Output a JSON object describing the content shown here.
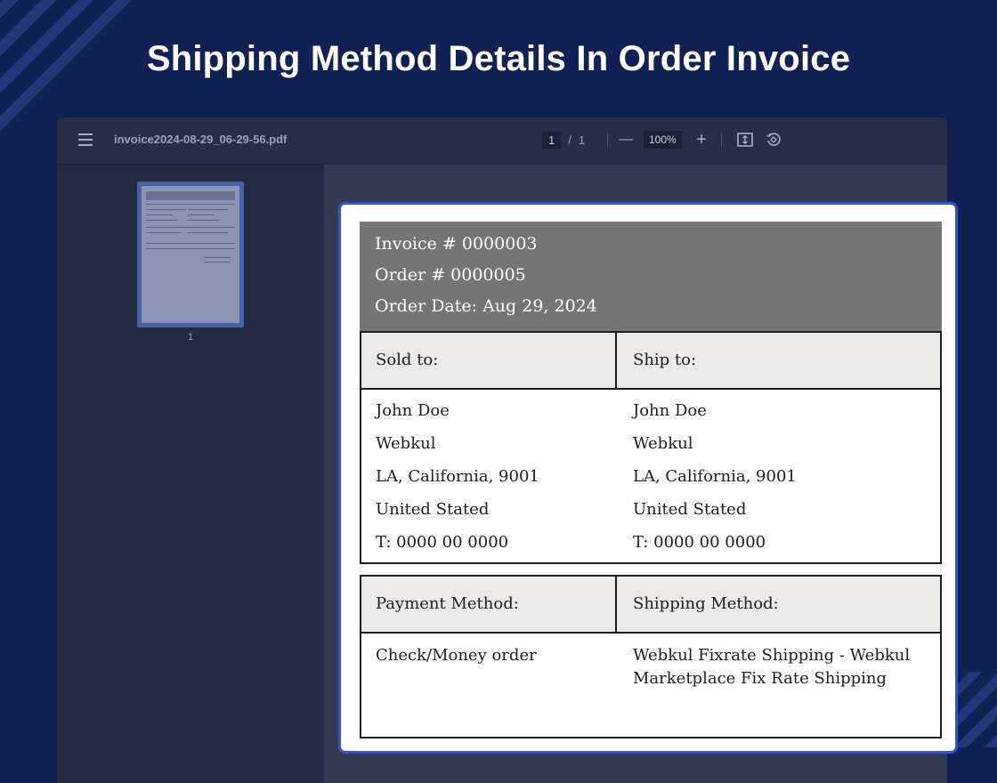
{
  "headline": "Shipping Method Details In Order Invoice",
  "viewer": {
    "file_name": "invoice2024-08-29_06-29-56.pdf",
    "page_current": "1",
    "page_separator": "/",
    "page_total": "1",
    "zoom": "100%",
    "zoom_out_symbol": "—",
    "zoom_in_symbol": "+",
    "thumbnail_label": "1"
  },
  "invoice": {
    "invoice_no": "Invoice # 0000003",
    "order_no": "Order # 0000005",
    "order_date": "Order Date: Aug 29, 2024",
    "sold_to_label": "Sold to:",
    "ship_to_label": "Ship to:",
    "sold_to": {
      "name": "John Doe",
      "company": "Webkul",
      "address": "LA, California, 9001",
      "country": "United Stated",
      "phone": "T: 0000 00 0000"
    },
    "ship_to": {
      "name": "John Doe",
      "company": "Webkul",
      "address": "LA, California, 9001",
      "country": "United Stated",
      "phone": "T: 0000 00 0000"
    },
    "payment_method_label": "Payment Method:",
    "shipping_method_label": "Shipping Method:",
    "payment_method": "Check/Money order",
    "shipping_method_line1": "Webkul Fixrate Shipping - Webkul",
    "shipping_method_line2": "Marketplace Fix Rate Shipping"
  },
  "colors": {
    "background": "#122154",
    "card_border": "#2f55d4",
    "invoice_header": "#757575",
    "table_header": "#ebeae8"
  },
  "icons": [
    "menu-icon",
    "fit-page-icon",
    "rotate-icon"
  ]
}
